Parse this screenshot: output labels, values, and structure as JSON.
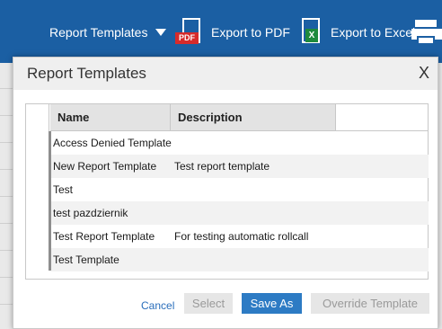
{
  "toolbar": {
    "report_templates_label": "Report Templates",
    "export_pdf_label": "Export to PDF",
    "pdf_badge": "PDF",
    "export_excel_label": "Export to Excel",
    "excel_badge": "X"
  },
  "modal": {
    "title": "Report Templates",
    "close_label": "X",
    "columns": {
      "name": "Name",
      "description": "Description"
    },
    "rows": [
      {
        "name": "Access Denied Template",
        "description": ""
      },
      {
        "name": "New Report Template",
        "description": "Test report template"
      },
      {
        "name": "Test",
        "description": ""
      },
      {
        "name": "test pazdziernik",
        "description": ""
      },
      {
        "name": "Test Report Template",
        "description": "For testing automatic rollcall"
      },
      {
        "name": "Test Template",
        "description": ""
      }
    ],
    "buttons": {
      "cancel": "Cancel",
      "select": "Select",
      "save_as": "Save As",
      "override": "Override Template"
    }
  },
  "colors": {
    "toolbar_bg": "#1b5fa3",
    "primary_button": "#2d7bc4",
    "disabled_button": "#e6e6e6",
    "link": "#2a6ebb",
    "pdf_red": "#d62b2b",
    "excel_green": "#1e8a3c"
  }
}
